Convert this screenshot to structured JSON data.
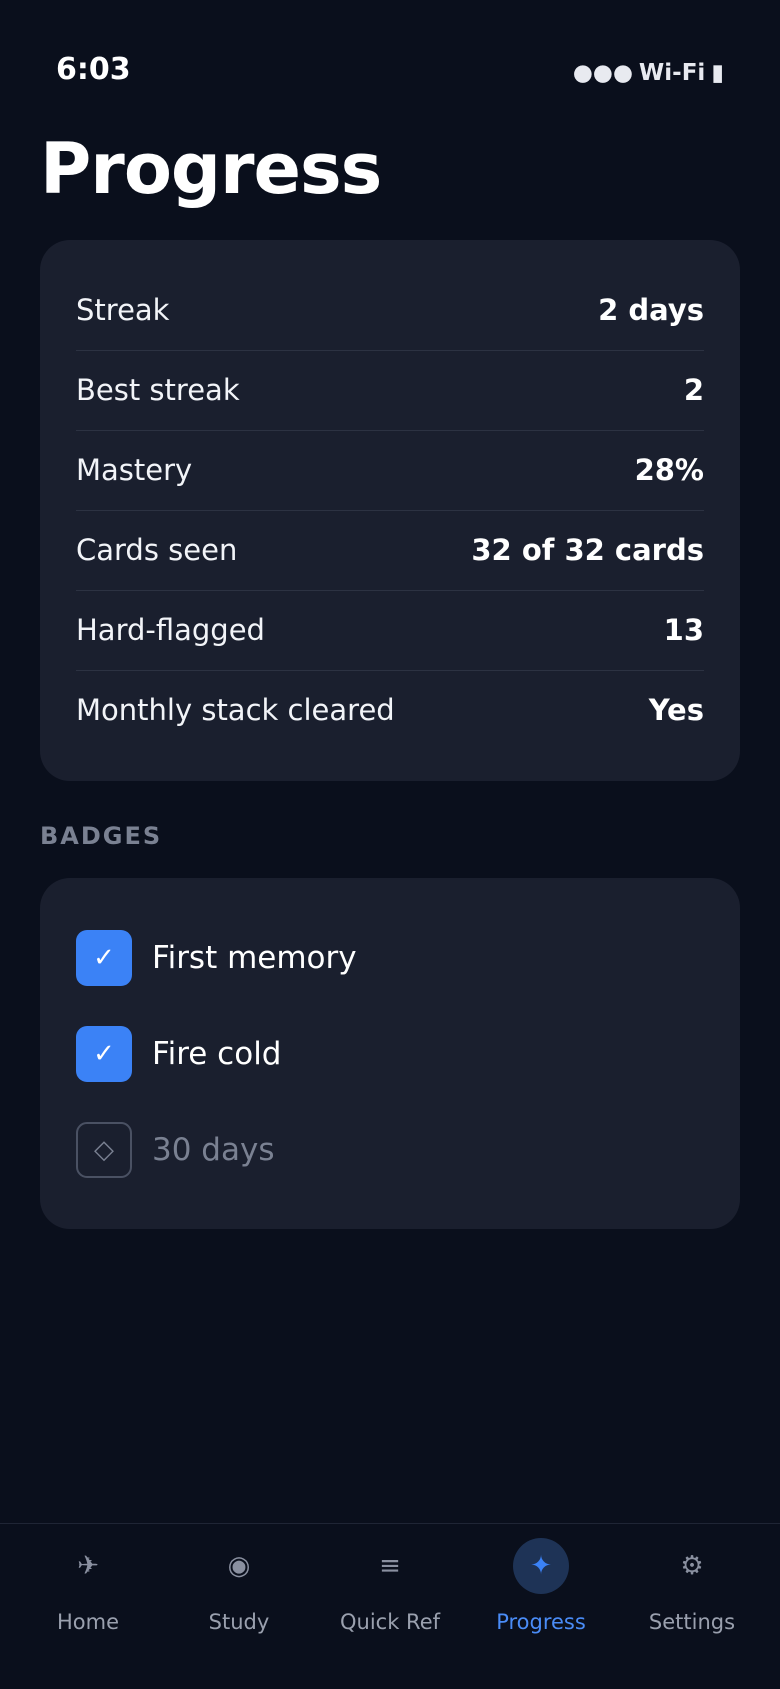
{
  "status_bar": {
    "time": "6:03",
    "signal": "●●●",
    "wifi": "Wi-Fi",
    "battery": "▮"
  },
  "page": {
    "title": "Progress"
  },
  "stats": [
    {
      "label": "Streak",
      "value": "2 days"
    },
    {
      "label": "Best streak",
      "value": "2"
    },
    {
      "label": "Mastery",
      "value": "28%"
    },
    {
      "label": "Cards seen",
      "value": "32 of 32 cards"
    },
    {
      "label": "Hard-flagged",
      "value": "13"
    },
    {
      "label": "Monthly stack cleared",
      "value": "Yes"
    }
  ],
  "badges": {
    "heading": "BADGES",
    "items": [
      {
        "label": "First memory",
        "icon": "check-icon",
        "glyph": "✓",
        "earned": true
      },
      {
        "label": "Fire cold",
        "icon": "check-icon",
        "glyph": "✓",
        "earned": true
      },
      {
        "label": "30 days",
        "icon": "diamond-outline-icon",
        "glyph": "◇",
        "earned": false
      }
    ]
  },
  "tab_bar": {
    "active": "Progress",
    "tabs": [
      {
        "label": "Home",
        "icon": "airplane-icon",
        "glyph": "✈"
      },
      {
        "label": "Study",
        "icon": "target-icon",
        "glyph": "◉"
      },
      {
        "label": "Quick Ref",
        "icon": "list-icon",
        "glyph": "≡"
      },
      {
        "label": "Progress",
        "icon": "sparkle-icon",
        "glyph": "✦"
      },
      {
        "label": "Settings",
        "icon": "gear-icon",
        "glyph": "⚙"
      }
    ]
  },
  "colors": {
    "background": "#0a0f1c",
    "card": "#1a1f2e",
    "accent": "#3b82f6",
    "muted": "#7a8192"
  }
}
